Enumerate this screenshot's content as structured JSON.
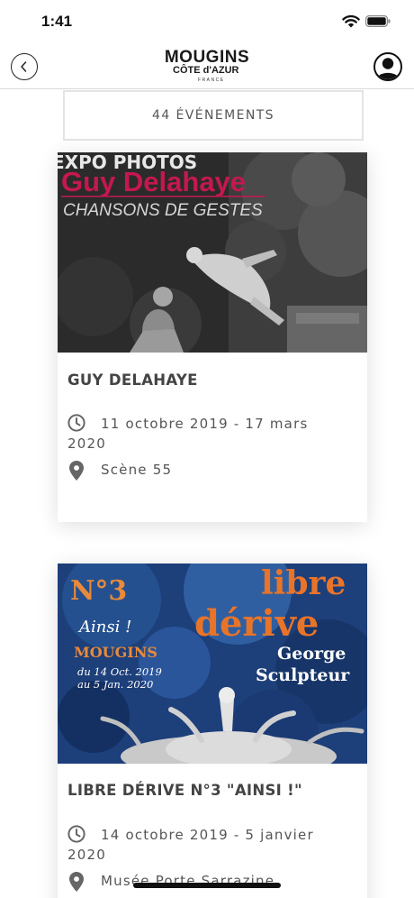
{
  "status_bar": {
    "time": "1:41",
    "icons": [
      "wifi-icon",
      "battery-icon"
    ]
  },
  "header": {
    "back_icon": "chevron-left-icon",
    "logo": {
      "main": "MOUGINS",
      "sub": "CÔTE d'AZUR",
      "country": "FRANCE"
    },
    "profile_icon": "user-icon"
  },
  "events_count": "44 ÉVÉNEMENTS",
  "events": [
    {
      "title": "GUY DELAHAYE",
      "date": "11 octobre 2019 - 17 mars 2020",
      "location": "Scène 55",
      "image": {
        "lines": [
          "EXPO PHOTOS",
          "Guy Delahaye",
          "CHANSONS DE GESTES"
        ],
        "colors": {
          "background": "#2b2b2b",
          "headline": "#c4184f"
        }
      }
    },
    {
      "title": "LIBRE DÉRIVE N°3 \"AINSI !\"",
      "date": "14 octobre 2019 - 5 janvier 2020",
      "location": "Musée Porte Sarrazine",
      "image": {
        "lines": [
          "N°3",
          "Ainsi !",
          "MOUGINS",
          "du 14 Oct. 2019",
          "au 5 Jan. 2020",
          "libre",
          "dérive",
          "George",
          "Sculpteur"
        ],
        "colors": {
          "background": "#1d3f7a",
          "headline": "#e8742a",
          "accent": "#e98a3a"
        }
      }
    }
  ],
  "colors": {
    "text": "#555555",
    "title": "#444444",
    "border": "#e4e4e4"
  }
}
